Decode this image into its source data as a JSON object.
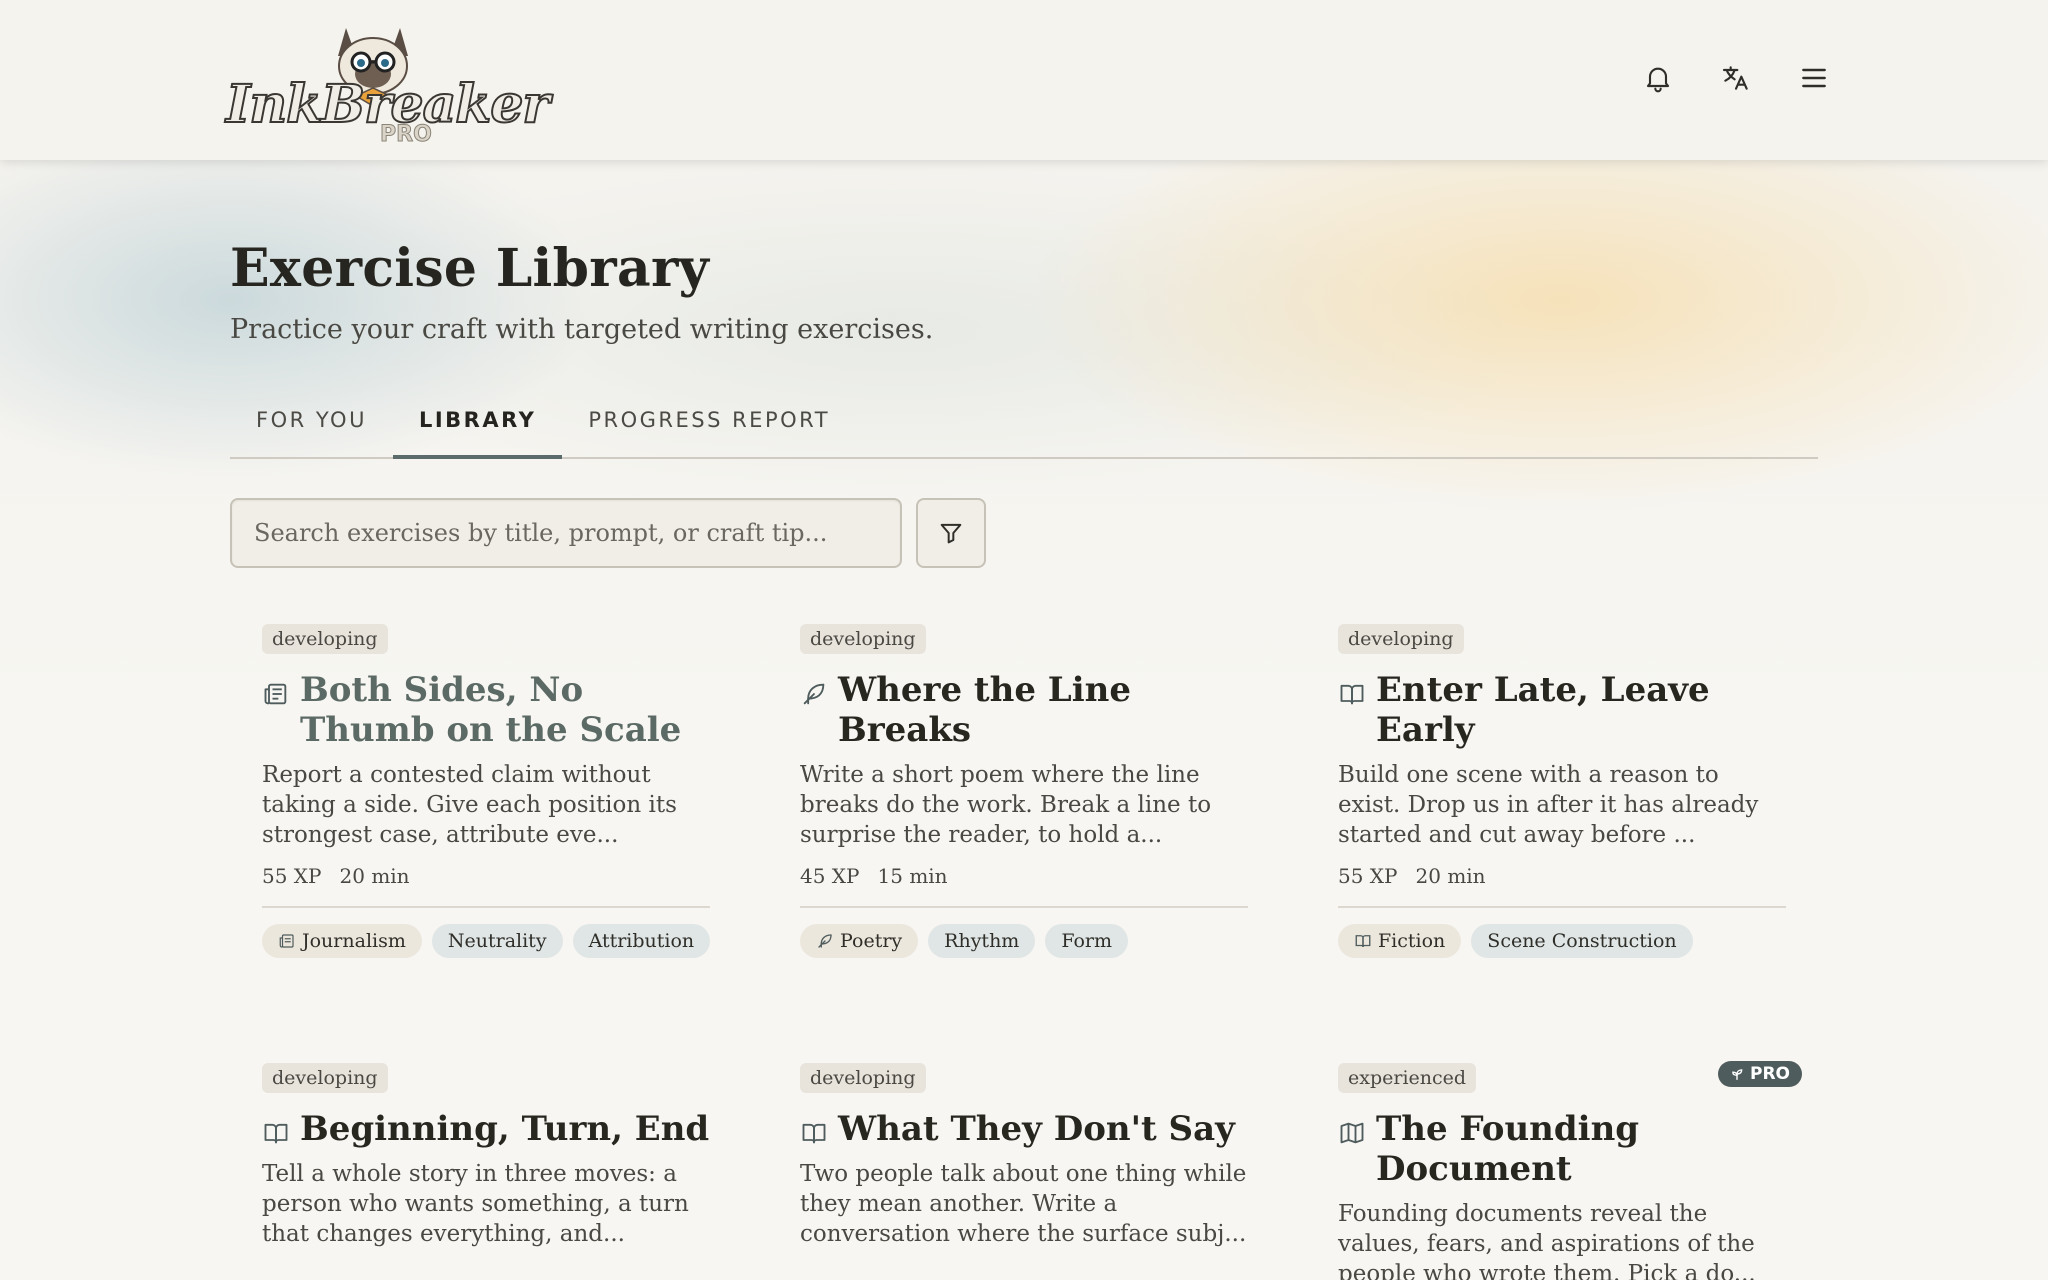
{
  "app": {
    "brand": "InkBreaker",
    "brand_tier": "PRO"
  },
  "header": {
    "icons": [
      "bell-icon",
      "translate-icon",
      "menu-icon"
    ]
  },
  "page": {
    "title": "Exercise Library",
    "subtitle": "Practice your craft with targeted writing exercises."
  },
  "tabs": [
    {
      "label": "FOR YOU",
      "active": false
    },
    {
      "label": "LIBRARY",
      "active": true
    },
    {
      "label": "PROGRESS REPORT",
      "active": false
    }
  ],
  "search": {
    "placeholder": "Search exercises by title, prompt, or craft tip...",
    "value": ""
  },
  "colors": {
    "accent": "#5b6b6c",
    "pro_badge": "#4f5c5d",
    "tag_bg": "#dfe6e5"
  },
  "cards": [
    {
      "level": "developing",
      "icon": "newspaper-icon",
      "title": "Both Sides, No Thumb on the Scale",
      "description": "Report a contested claim without taking a side. Give each position its strongest case, attribute eve...",
      "xp": "55 XP",
      "time": "20 min",
      "tags": [
        "Journalism",
        "Neutrality",
        "Attribution"
      ]
    },
    {
      "level": "developing",
      "icon": "feather-icon",
      "title": "Where the Line Breaks",
      "description": "Write a short poem where the line breaks do the work. Break a line to surprise the reader, to hold a...",
      "xp": "45 XP",
      "time": "15 min",
      "tags": [
        "Poetry",
        "Rhythm",
        "Form"
      ]
    },
    {
      "level": "developing",
      "icon": "book-icon",
      "title": "Enter Late, Leave Early",
      "description": "Build one scene with a reason to exist. Drop us in after it has already started and cut away before ...",
      "xp": "55 XP",
      "time": "20 min",
      "tags": [
        "Fiction",
        "Scene Construction"
      ]
    },
    {
      "level": "developing",
      "icon": "book-icon",
      "title": "Beginning, Turn, End",
      "description": "Tell a whole story in three moves: a person who wants something, a turn that changes everything, and..."
    },
    {
      "level": "developing",
      "icon": "book-icon",
      "title": "What They Don't Say",
      "description": "Two people talk about one thing while they mean another. Write a conversation where the surface subj..."
    },
    {
      "level": "experienced",
      "icon": "map-icon",
      "title": "The Founding Document",
      "description": "Founding documents reveal the values, fears, and aspirations of the people who wrote them. Pick a do...",
      "badge": "PRO"
    }
  ]
}
